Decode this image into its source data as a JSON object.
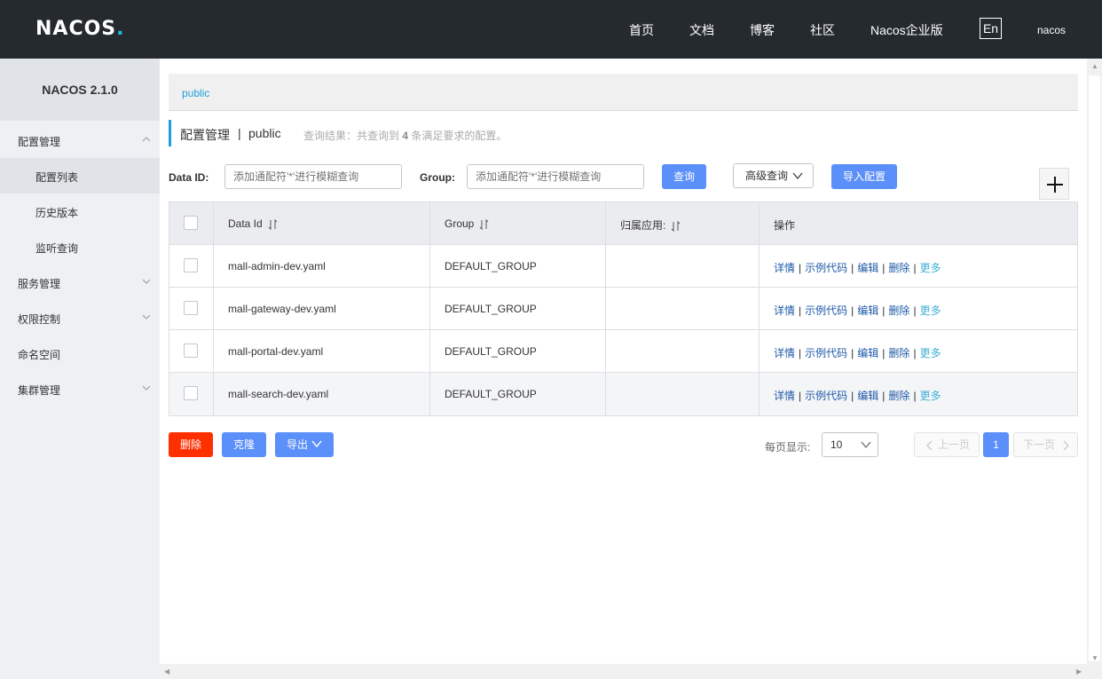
{
  "header": {
    "logo": "NACOS",
    "logo_dot": ".",
    "nav": [
      "首页",
      "文档",
      "博客",
      "社区",
      "Nacos企业版"
    ],
    "lang": "En",
    "user": "nacos"
  },
  "sidebar": {
    "version": "NACOS 2.1.0",
    "items": [
      {
        "label": "配置管理",
        "expanded": true
      },
      {
        "label": "配置列表",
        "sub": true,
        "active": true
      },
      {
        "label": "历史版本",
        "sub": true
      },
      {
        "label": "监听查询",
        "sub": true
      },
      {
        "label": "服务管理"
      },
      {
        "label": "权限控制"
      },
      {
        "label": "命名空间"
      },
      {
        "label": "集群管理"
      }
    ]
  },
  "breadcrumb": {
    "namespace": "public"
  },
  "title": {
    "main": "配置管理",
    "sep": "|",
    "namespace": "public",
    "hint_prefix": "查询结果：共查询到",
    "hint_count": "4",
    "hint_suffix": "条满足要求的配置。"
  },
  "filter": {
    "data_id_label": "Data ID:",
    "data_id_placeholder": "添加通配符'*'进行模糊查询",
    "group_label": "Group:",
    "group_placeholder": "添加通配符'*'进行模糊查询",
    "search_btn": "查询",
    "advanced_btn": "高级查询",
    "import_btn": "导入配置",
    "add_icon": "plus-icon"
  },
  "table": {
    "headers": [
      "Data Id",
      "Group",
      "归属应用:",
      "操作"
    ],
    "rows": [
      {
        "data_id": "mall-admin-dev.yaml",
        "group": "DEFAULT_GROUP",
        "app": ""
      },
      {
        "data_id": "mall-gateway-dev.yaml",
        "group": "DEFAULT_GROUP",
        "app": ""
      },
      {
        "data_id": "mall-portal-dev.yaml",
        "group": "DEFAULT_GROUP",
        "app": ""
      },
      {
        "data_id": "mall-search-dev.yaml",
        "group": "DEFAULT_GROUP",
        "app": ""
      }
    ],
    "actions": {
      "detail": "详情",
      "sample": "示例代码",
      "edit": "编辑",
      "delete": "删除",
      "more": "更多",
      "sep": "|"
    }
  },
  "bulk": {
    "delete": "删除",
    "clone": "克隆",
    "export": "导出"
  },
  "pagination": {
    "page_size_label": "每页显示:",
    "page_size": "10",
    "prev": "上一页",
    "current": "1",
    "next": "下一页"
  },
  "colors": {
    "header_bg": "#252a2f",
    "primary": "#5b8ff9",
    "danger": "#ff3000",
    "accent": "#1e9fd8"
  }
}
